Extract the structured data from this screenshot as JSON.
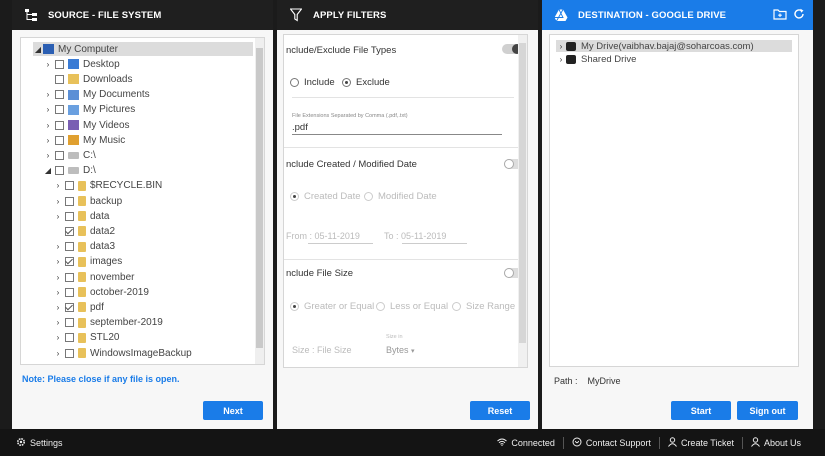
{
  "source": {
    "title": "SOURCE - FILE SYSTEM",
    "tree": [
      {
        "label": "My Computer",
        "level": 0,
        "arrow": "◢",
        "checkbox": false,
        "icon": "computer",
        "checked": false
      },
      {
        "label": "Desktop",
        "level": 1,
        "arrow": "›",
        "checkbox": true,
        "icon": "desktop",
        "checked": false
      },
      {
        "label": "Downloads",
        "level": 1,
        "arrow": "",
        "checkbox": true,
        "icon": "downloads",
        "checked": false
      },
      {
        "label": "My Documents",
        "level": 1,
        "arrow": "›",
        "checkbox": true,
        "icon": "documents",
        "checked": false
      },
      {
        "label": "My Pictures",
        "level": 1,
        "arrow": "›",
        "checkbox": true,
        "icon": "pictures",
        "checked": false
      },
      {
        "label": "My Videos",
        "level": 1,
        "arrow": "›",
        "checkbox": true,
        "icon": "videos",
        "checked": false
      },
      {
        "label": "My Music",
        "level": 1,
        "arrow": "›",
        "checkbox": true,
        "icon": "music",
        "checked": false
      },
      {
        "label": "C:\\",
        "level": 1,
        "arrow": "›",
        "checkbox": true,
        "icon": "drive",
        "checked": false
      },
      {
        "label": "D:\\",
        "level": 1,
        "arrow": "◢",
        "checkbox": true,
        "icon": "drive",
        "checked": false
      },
      {
        "label": "$RECYCLE.BIN",
        "level": 2,
        "arrow": "›",
        "checkbox": true,
        "icon": "folder",
        "checked": false
      },
      {
        "label": "backup",
        "level": 2,
        "arrow": "›",
        "checkbox": true,
        "icon": "folder",
        "checked": false
      },
      {
        "label": "data",
        "level": 2,
        "arrow": "›",
        "checkbox": true,
        "icon": "folder",
        "checked": false
      },
      {
        "label": "data2",
        "level": 2,
        "arrow": "",
        "checkbox": true,
        "icon": "folder",
        "checked": true
      },
      {
        "label": "data3",
        "level": 2,
        "arrow": "›",
        "checkbox": true,
        "icon": "folder",
        "checked": false
      },
      {
        "label": "images",
        "level": 2,
        "arrow": "›",
        "checkbox": true,
        "icon": "folder",
        "checked": true
      },
      {
        "label": "november",
        "level": 2,
        "arrow": "›",
        "checkbox": true,
        "icon": "folder",
        "checked": false
      },
      {
        "label": "october-2019",
        "level": 2,
        "arrow": "›",
        "checkbox": true,
        "icon": "folder",
        "checked": false
      },
      {
        "label": "pdf",
        "level": 2,
        "arrow": "›",
        "checkbox": true,
        "icon": "folder",
        "checked": true
      },
      {
        "label": "september-2019",
        "level": 2,
        "arrow": "›",
        "checkbox": true,
        "icon": "folder",
        "checked": false
      },
      {
        "label": "STL20",
        "level": 2,
        "arrow": "›",
        "checkbox": true,
        "icon": "folder",
        "checked": false
      },
      {
        "label": "WindowsImageBackup",
        "level": 2,
        "arrow": "›",
        "checkbox": true,
        "icon": "folder",
        "checked": false
      }
    ],
    "note": "Note: Please close if any file is open.",
    "next_label": "Next"
  },
  "filters": {
    "title": "APPLY FILTERS",
    "file_types": {
      "title": "nclude/Exclude File Types",
      "include_label": "Include",
      "exclude_label": "Exclude",
      "ext_caption": "File Extensions Separated by Comma (.pdf,.txt)",
      "ext_value": ".pdf"
    },
    "date": {
      "title": "nclude Created / Modified Date",
      "created_label": "Created Date",
      "modified_label": "Modified Date",
      "from_label": "From :",
      "from_value": "05-11-2019",
      "to_label": "To :",
      "to_value": "05-11-2019"
    },
    "size": {
      "title": "nclude File Size",
      "opt1": "Greater or Equal",
      "opt2": "Less or Equal",
      "opt3": "Size Range",
      "size_label": "Size :",
      "size_placeholder": "File Size",
      "unit_caption": "Size in",
      "unit_value": "Bytes"
    },
    "reset_label": "Reset"
  },
  "destination": {
    "title": "DESTINATION - GOOGLE DRIVE",
    "tree": [
      {
        "label": "My Drive(vaibhav.bajaj@soharcoas.com)",
        "arrow": "›"
      },
      {
        "label": "Shared Drive",
        "arrow": "›"
      }
    ],
    "path_label": "Path :",
    "path_value": "MyDrive",
    "start_label": "Start",
    "signout_label": "Sign out"
  },
  "status": {
    "settings": "Settings",
    "connected": "Connected",
    "contact": "Contact Support",
    "ticket": "Create Ticket",
    "about": "About Us"
  },
  "colors": {
    "accent": "#1a7ce8",
    "dark": "#1f1f1f"
  }
}
